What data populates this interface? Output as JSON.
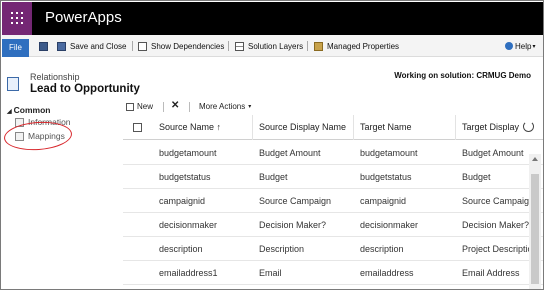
{
  "app": {
    "title": "PowerApps"
  },
  "command_bar": {
    "file_label": "File",
    "save_and_close_label": "Save and Close",
    "show_dependencies_label": "Show Dependencies",
    "solution_layers_label": "Solution Layers",
    "managed_properties_label": "Managed Properties",
    "help_label": "Help",
    "help_caret": "▾"
  },
  "header": {
    "entity_type": "Relationship",
    "entity_name": "Lead to Opportunity",
    "solution_text": "Working on solution: CRMUG Demo"
  },
  "sidebar": {
    "group_label": "Common",
    "group_toggle": "◢",
    "items": [
      {
        "label": "Information"
      },
      {
        "label": "Mappings"
      }
    ]
  },
  "grid_toolbar": {
    "new_label": "New",
    "delete_symbol": "✕",
    "more_actions_label": "More Actions",
    "more_caret": "▾"
  },
  "grid": {
    "columns": [
      {
        "label": "Source Name ↑"
      },
      {
        "label": "Source Display Name"
      },
      {
        "label": "Target Name"
      },
      {
        "label": "Target Display"
      }
    ],
    "rows": [
      {
        "source_name": "budgetamount",
        "source_display": "Budget Amount",
        "target_name": "budgetamount",
        "target_display": "Budget Amount"
      },
      {
        "source_name": "budgetstatus",
        "source_display": "Budget",
        "target_name": "budgetstatus",
        "target_display": "Budget"
      },
      {
        "source_name": "campaignid",
        "source_display": "Source Campaign",
        "target_name": "campaignid",
        "target_display": "Source Campaign"
      },
      {
        "source_name": "decisionmaker",
        "source_display": "Decision Maker?",
        "target_name": "decisionmaker",
        "target_display": "Decision Maker?"
      },
      {
        "source_name": "description",
        "source_display": "Description",
        "target_name": "description",
        "target_display": "Project Description"
      },
      {
        "source_name": "emailaddress1",
        "source_display": "Email",
        "target_name": "emailaddress",
        "target_display": "Email Address"
      }
    ]
  },
  "colors": {
    "brand_purple": "#742774",
    "file_blue": "#2f6fbf",
    "annotation_red": "#d8262b"
  }
}
